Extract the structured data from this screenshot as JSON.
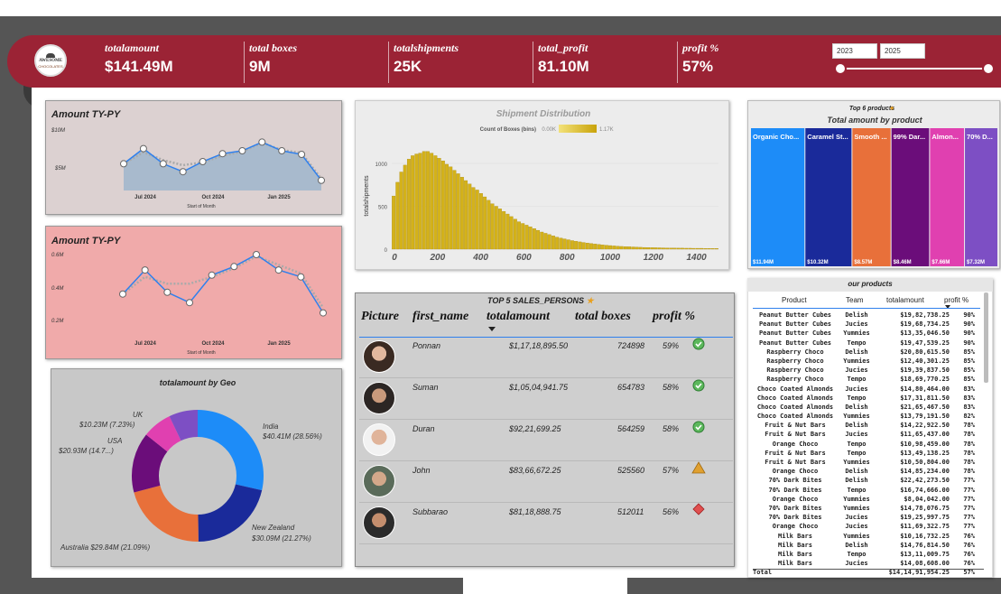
{
  "kpis": [
    {
      "label": "totalamount",
      "value": "$141.49M"
    },
    {
      "label": "total boxes",
      "value": "9M"
    },
    {
      "label": "totalshipments",
      "value": "25K"
    },
    {
      "label": "total_profit",
      "value": "81.10M"
    },
    {
      "label": "profit %",
      "value": "57%"
    }
  ],
  "year_slider": {
    "start": "2023",
    "end": "2025"
  },
  "logo": {
    "line1": "AWESOME",
    "line2": "CHOCOLATES"
  },
  "colors": {
    "header": "#9b2335",
    "accent_line": "#2f80ed",
    "bars": "#d4b21a"
  },
  "chart_data": [
    {
      "type": "area",
      "title": "Amount TY-PY",
      "xlabel": "Start of Month",
      "x_ticks": [
        "Jul 2024",
        "Oct 2024",
        "Jan 2025"
      ],
      "y_ticks": [
        "$10M",
        "$5M"
      ],
      "series": [
        {
          "values": [
            3.7,
            5.8,
            3.7,
            2.6,
            4.0,
            5.1,
            5.5,
            6.7,
            5.5,
            5.0,
            1.4
          ]
        },
        {
          "values": [
            3.7,
            5.3,
            4.2,
            3.5,
            3.9,
            4.8,
            5.4,
            6.6,
            5.6,
            5.2,
            1.6
          ]
        }
      ]
    },
    {
      "type": "line",
      "title": "Amount TY-PY",
      "xlabel": "Start of Month",
      "x_ticks": [
        "Jul 2024",
        "Oct 2024",
        "Jan 2025"
      ],
      "y_ticks": [
        "0.6M",
        "0.4M",
        "0.2M"
      ],
      "series": [
        {
          "values": [
            0.27,
            0.41,
            0.28,
            0.22,
            0.38,
            0.43,
            0.5,
            0.41,
            0.37,
            0.16
          ]
        },
        {
          "values": [
            0.27,
            0.37,
            0.33,
            0.33,
            0.37,
            0.42,
            0.49,
            0.44,
            0.39,
            0.19
          ]
        }
      ]
    },
    {
      "type": "bar",
      "title": "Shipment Distribution",
      "legend_title": "Count of Boxes (bins)",
      "legend_min": "0.00K",
      "legend_max": "1.17K",
      "ylabel": "totalshipments",
      "x_ticks": [
        "0",
        "200",
        "400",
        "600",
        "800",
        "1000",
        "1200",
        "1400"
      ],
      "y_ticks": [
        "1000",
        "500",
        "0"
      ],
      "ylim": [
        0,
        1200
      ],
      "values": [
        620,
        780,
        900,
        980,
        1050,
        1090,
        1110,
        1120,
        1140,
        1140,
        1120,
        1090,
        1060,
        1030,
        990,
        960,
        920,
        880,
        840,
        800,
        760,
        720,
        690,
        650,
        610,
        570,
        530,
        500,
        470,
        440,
        410,
        380,
        350,
        320,
        300,
        280,
        260,
        240,
        220,
        200,
        185,
        170,
        155,
        140,
        130,
        120,
        110,
        100,
        92,
        85,
        78,
        72,
        66,
        60,
        55,
        50,
        46,
        42,
        38,
        35,
        32,
        30,
        28,
        26,
        24,
        22,
        20,
        19,
        18,
        17,
        16,
        15,
        14,
        13,
        13,
        12,
        12,
        11,
        11,
        10,
        10,
        10,
        9,
        9,
        9,
        8
      ]
    },
    {
      "type": "bar",
      "title": "Top 6 products",
      "subtitle": "Total amount by product",
      "categories": [
        "Organic Cho...",
        "Caramel St...",
        "Smooth ...",
        "99% Dar...",
        "Almon...",
        "70% D..."
      ],
      "values": [
        11.94,
        10.32,
        8.57,
        8.46,
        7.66,
        7.32
      ],
      "value_labels": [
        "$11.94M",
        "$10.32M",
        "$8.57M",
        "$8.46M",
        "$7.66M",
        "$7.32M"
      ],
      "colors": [
        "#1d8cf8",
        "#1a2a9a",
        "#e8703a",
        "#6b0d7a",
        "#e040b0",
        "#7d4fc4"
      ]
    },
    {
      "type": "pie",
      "title": "totalamount by Geo",
      "slices": [
        {
          "name": "India",
          "value": 40.41,
          "label": "$40.41M (28.56%)",
          "color": "#1d8cf8"
        },
        {
          "name": "New Zealand",
          "value": 30.09,
          "label": "$30.09M (21.27%)",
          "color": "#1a2a9a"
        },
        {
          "name": "Australia",
          "value": 29.84,
          "label": "Australia $29.84M (21.09%)",
          "color": "#e8703a"
        },
        {
          "name": "USA",
          "value": 20.93,
          "label": "$20.93M (14.7...)",
          "color": "#6b0d7a"
        },
        {
          "name": "UK",
          "value": 10.23,
          "label": "$10.23M (7.23%)",
          "color": "#e040b0"
        },
        {
          "name": "Other",
          "value": 10.0,
          "label": "",
          "color": "#7d4fc4"
        }
      ]
    }
  ],
  "salespersons": {
    "title": "TOP 5 SALES_PERSONS",
    "columns": [
      "Picture",
      "first_name",
      "totalamount",
      "total boxes",
      "profit %"
    ],
    "rows": [
      {
        "name": "Ponnan",
        "amount": "$1,17,18,895.50",
        "boxes": "724898",
        "profit": "59%",
        "status": "check"
      },
      {
        "name": "Suman",
        "amount": "$1,05,04,941.75",
        "boxes": "654783",
        "profit": "58%",
        "status": "check"
      },
      {
        "name": "Duran",
        "amount": "$92,21,699.25",
        "boxes": "564259",
        "profit": "58%",
        "status": "check"
      },
      {
        "name": "John",
        "amount": "$83,66,672.25",
        "boxes": "525560",
        "profit": "57%",
        "status": "warning"
      },
      {
        "name": "Subbarao",
        "amount": "$81,18,888.75",
        "boxes": "512011",
        "profit": "56%",
        "status": "alert"
      }
    ]
  },
  "products_table": {
    "title": "our products",
    "columns": [
      "Product",
      "Team",
      "totalamount",
      "profit %"
    ],
    "rows": [
      [
        "Peanut Butter Cubes",
        "Delish",
        "$19,82,738.25",
        "90%"
      ],
      [
        "Peanut Butter Cubes",
        "Jucies",
        "$19,68,734.25",
        "90%"
      ],
      [
        "Peanut Butter Cubes",
        "Yummies",
        "$13,35,046.50",
        "90%"
      ],
      [
        "Peanut Butter Cubes",
        "Tempo",
        "$19,47,539.25",
        "90%"
      ],
      [
        "Raspberry Choco",
        "Delish",
        "$20,80,615.50",
        "85%"
      ],
      [
        "Raspberry Choco",
        "Yummies",
        "$12,40,301.25",
        "85%"
      ],
      [
        "Raspberry Choco",
        "Jucies",
        "$19,39,837.50",
        "85%"
      ],
      [
        "Raspberry Choco",
        "Tempo",
        "$18,69,770.25",
        "85%"
      ],
      [
        "Choco Coated Almonds",
        "Jucies",
        "$14,80,464.00",
        "83%"
      ],
      [
        "Choco Coated Almonds",
        "Tempo",
        "$17,31,811.50",
        "83%"
      ],
      [
        "Choco Coated Almonds",
        "Delish",
        "$21,65,467.50",
        "83%"
      ],
      [
        "Choco Coated Almonds",
        "Yummies",
        "$13,79,191.50",
        "82%"
      ],
      [
        "Fruit & Nut Bars",
        "Delish",
        "$14,22,922.50",
        "78%"
      ],
      [
        "Fruit & Nut Bars",
        "Jucies",
        "$11,65,437.00",
        "78%"
      ],
      [
        "Orange Choco",
        "Tempo",
        "$10,98,459.00",
        "78%"
      ],
      [
        "Fruit & Nut Bars",
        "Tempo",
        "$13,49,138.25",
        "78%"
      ],
      [
        "Fruit & Nut Bars",
        "Yummies",
        "$10,50,804.00",
        "78%"
      ],
      [
        "Orange Choco",
        "Delish",
        "$14,85,234.00",
        "78%"
      ],
      [
        "70% Dark Bites",
        "Delish",
        "$22,42,273.50",
        "77%"
      ],
      [
        "70% Dark Bites",
        "Tempo",
        "$16,74,666.00",
        "77%"
      ],
      [
        "Orange Choco",
        "Yummies",
        "$8,04,042.00",
        "77%"
      ],
      [
        "70% Dark Bites",
        "Yummies",
        "$14,78,076.75",
        "77%"
      ],
      [
        "70% Dark Bites",
        "Jucies",
        "$19,25,997.75",
        "77%"
      ],
      [
        "Orange Choco",
        "Jucies",
        "$11,69,322.75",
        "77%"
      ],
      [
        "Milk Bars",
        "Yummies",
        "$10,16,732.25",
        "76%"
      ],
      [
        "Milk Bars",
        "Delish",
        "$14,76,814.50",
        "76%"
      ],
      [
        "Milk Bars",
        "Tempo",
        "$13,11,009.75",
        "76%"
      ],
      [
        "Milk Bars",
        "Jucies",
        "$14,08,608.00",
        "76%"
      ]
    ],
    "total_label": "Total",
    "total_amount": "$14,14,91,954.25",
    "total_pct": "57%"
  }
}
